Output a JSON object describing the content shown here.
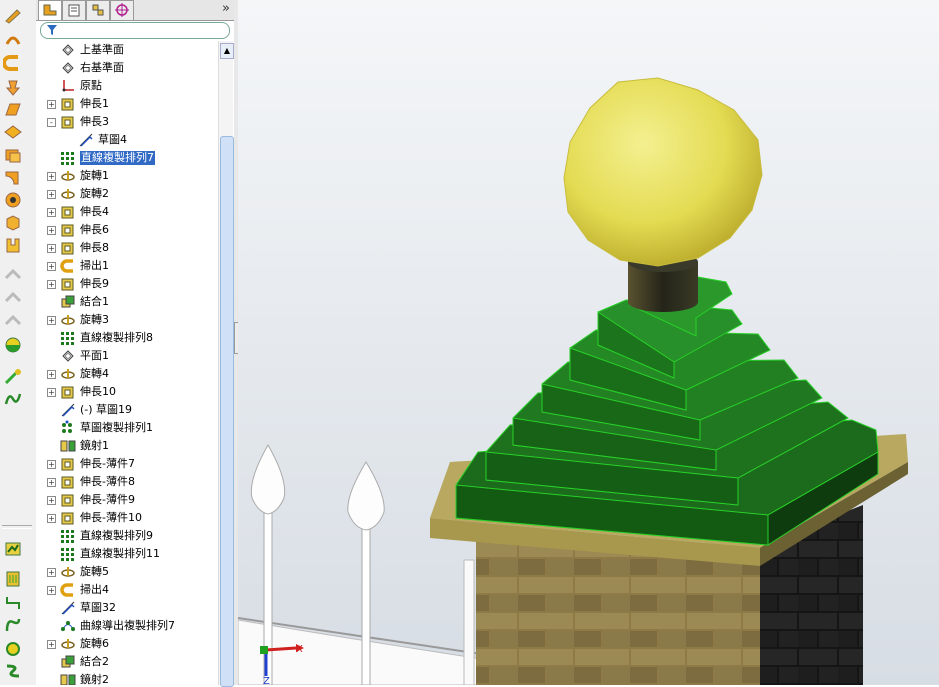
{
  "feature_tree": [
    {
      "label": "上基準面",
      "icon": "plane-icon",
      "expand": "",
      "indent": 1
    },
    {
      "label": "右基準面",
      "icon": "plane-icon",
      "expand": "",
      "indent": 1
    },
    {
      "label": "原點",
      "icon": "origin-icon",
      "expand": "",
      "indent": 1
    },
    {
      "label": "伸長1",
      "icon": "extrude-icon",
      "expand": "+",
      "indent": 1
    },
    {
      "label": "伸長3",
      "icon": "extrude-icon",
      "expand": "-",
      "indent": 1
    },
    {
      "label": "草圖4",
      "icon": "sketch-icon",
      "expand": "",
      "indent": 2
    },
    {
      "label": "直線複製排列7",
      "icon": "linear-pattern-icon",
      "expand": "",
      "indent": 1,
      "selected": true
    },
    {
      "label": "旋轉1",
      "icon": "revolve-icon",
      "expand": "+",
      "indent": 1
    },
    {
      "label": "旋轉2",
      "icon": "revolve-icon",
      "expand": "+",
      "indent": 1
    },
    {
      "label": "伸長4",
      "icon": "extrude-icon",
      "expand": "+",
      "indent": 1
    },
    {
      "label": "伸長6",
      "icon": "extrude-icon",
      "expand": "+",
      "indent": 1
    },
    {
      "label": "伸長8",
      "icon": "extrude-icon",
      "expand": "+",
      "indent": 1
    },
    {
      "label": "掃出1",
      "icon": "sweep-icon",
      "expand": "+",
      "indent": 1
    },
    {
      "label": "伸長9",
      "icon": "extrude-icon",
      "expand": "+",
      "indent": 1
    },
    {
      "label": "結合1",
      "icon": "combine-icon",
      "expand": "",
      "indent": 1
    },
    {
      "label": "旋轉3",
      "icon": "revolve-icon",
      "expand": "+",
      "indent": 1
    },
    {
      "label": "直線複製排列8",
      "icon": "linear-pattern-icon",
      "expand": "",
      "indent": 1
    },
    {
      "label": "平面1",
      "icon": "plane-icon",
      "expand": "",
      "indent": 1
    },
    {
      "label": "旋轉4",
      "icon": "revolve-icon",
      "expand": "+",
      "indent": 1
    },
    {
      "label": "伸長10",
      "icon": "extrude-icon",
      "expand": "+",
      "indent": 1
    },
    {
      "label": "(-) 草圖19",
      "icon": "sketch-icon",
      "expand": "",
      "indent": 1
    },
    {
      "label": "草圖複製排列1",
      "icon": "sketch-pattern-icon",
      "expand": "",
      "indent": 1
    },
    {
      "label": "鏡射1",
      "icon": "mirror-icon",
      "expand": "",
      "indent": 1
    },
    {
      "label": "伸長-薄件7",
      "icon": "extrude-icon",
      "expand": "+",
      "indent": 1
    },
    {
      "label": "伸長-薄件8",
      "icon": "extrude-icon",
      "expand": "+",
      "indent": 1
    },
    {
      "label": "伸長-薄件9",
      "icon": "extrude-icon",
      "expand": "+",
      "indent": 1
    },
    {
      "label": "伸長-薄件10",
      "icon": "extrude-icon",
      "expand": "+",
      "indent": 1
    },
    {
      "label": "直線複製排列9",
      "icon": "linear-pattern-icon",
      "expand": "",
      "indent": 1
    },
    {
      "label": "直線複製排列11",
      "icon": "linear-pattern-icon",
      "expand": "",
      "indent": 1
    },
    {
      "label": "旋轉5",
      "icon": "revolve-icon",
      "expand": "+",
      "indent": 1
    },
    {
      "label": "掃出4",
      "icon": "sweep-icon",
      "expand": "+",
      "indent": 1
    },
    {
      "label": "草圖32",
      "icon": "sketch-icon",
      "expand": "",
      "indent": 1
    },
    {
      "label": "曲線導出複製排列7",
      "icon": "curve-pattern-icon",
      "expand": "",
      "indent": 1
    },
    {
      "label": "旋轉6",
      "icon": "revolve-icon",
      "expand": "+",
      "indent": 1
    },
    {
      "label": "結合2",
      "icon": "combine-icon",
      "expand": "",
      "indent": 1
    },
    {
      "label": "鏡射2",
      "icon": "mirror-icon",
      "expand": "",
      "indent": 1
    }
  ],
  "panel_tabs": [
    "feature-manager-tab",
    "property-manager-tab",
    "configuration-manager-tab",
    "dimxpert-tab"
  ],
  "collapse_glyph": "»",
  "triad": {
    "x_label": "X",
    "z_label": "Z"
  },
  "colors": {
    "selection": "#316ac5",
    "lamp": "#e6e05a",
    "roof_green": "#1f8a1f",
    "brick": "#8b6b3d"
  }
}
